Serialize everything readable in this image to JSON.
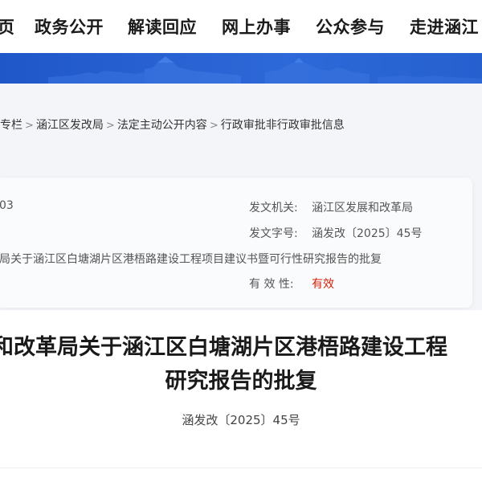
{
  "nav": {
    "items": [
      "页",
      "政务公开",
      "解读回应",
      "网上办事",
      "公众参与",
      "走进涵江"
    ]
  },
  "breadcrumb": [
    "专栏",
    "涵江区发改局",
    "法定主动公开内容",
    "行政审批非行政审批信息"
  ],
  "info": {
    "date_fragment": "03",
    "issuer_label": "发文机关:",
    "issuer_value": "涵江区发展和改革局",
    "docno_label": "发文字号:",
    "docno_value": "涵发改〔2025〕45号",
    "subject": "局关于涵江区白塘湖片区港梧路建设工程项目建议书暨可行性研究报告的批复",
    "validity_label": "有 效 性:",
    "validity_value": "有效"
  },
  "article": {
    "title_line1": "和改革局关于涵江区白塘湖片区港梧路建设工程",
    "title_line2": "研究报告的批复",
    "doc_number": "涵发改〔2025〕45号"
  },
  "colors": {
    "banner_blue": "#2660cf",
    "valid_red": "#d81e06"
  }
}
